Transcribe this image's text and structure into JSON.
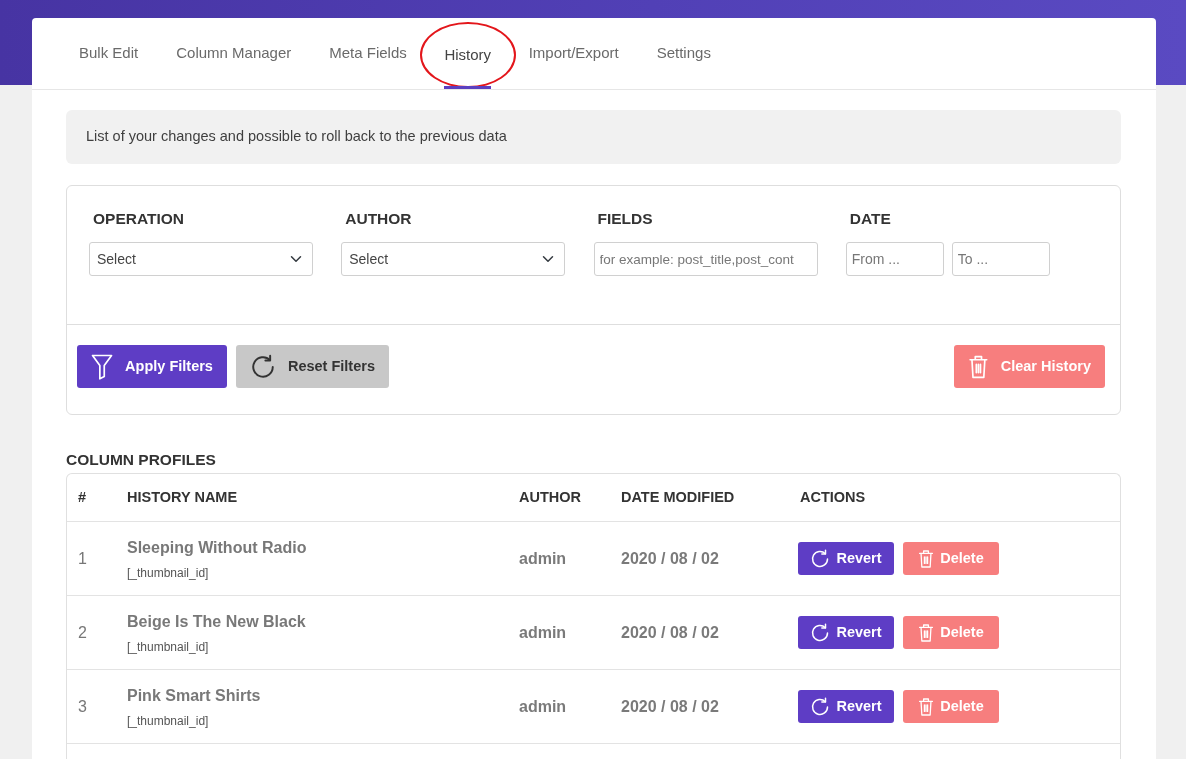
{
  "tabs": [
    {
      "label": "Bulk Edit",
      "selected": false,
      "circled": false
    },
    {
      "label": "Column Manager",
      "selected": false,
      "circled": false
    },
    {
      "label": "Meta Fields",
      "selected": false,
      "circled": false
    },
    {
      "label": "History",
      "selected": true,
      "circled": true
    },
    {
      "label": "Import/Export",
      "selected": false,
      "circled": false
    },
    {
      "label": "Settings",
      "selected": false,
      "circled": false
    }
  ],
  "notice": "List of your changes and possible to roll back to the previous data",
  "filters": [
    {
      "label": "OPERATION",
      "controls": [
        {
          "kind": "select",
          "value": "Select"
        }
      ]
    },
    {
      "label": "AUTHOR",
      "controls": [
        {
          "kind": "select",
          "value": "Select"
        }
      ]
    },
    {
      "label": "FIELDS",
      "controls": [
        {
          "kind": "text",
          "placeholder": "for example: post_title,post_cont"
        }
      ]
    },
    {
      "label": "DATE",
      "controls": [
        {
          "kind": "date",
          "placeholder": "From ..."
        },
        {
          "kind": "date",
          "placeholder": "To ..."
        }
      ]
    }
  ],
  "filter_buttons": [
    {
      "label": "Apply Filters",
      "kind": "apply"
    },
    {
      "label": "Reset Filters",
      "kind": "reset"
    },
    {
      "label": "Clear History",
      "kind": "clear"
    }
  ],
  "section_title": "COLUMN PROFILES",
  "table": {
    "columns": [
      "#",
      "HISTORY NAME",
      "AUTHOR",
      "DATE MODIFIED",
      "ACTIONS"
    ],
    "rows": [
      {
        "index": "1",
        "name": "Sleeping Without Radio",
        "field": "[_thumbnail_id]",
        "author": "admin",
        "date": "2020 / 08 / 02",
        "actions": [
          {
            "label": "Revert",
            "kind": "revert"
          },
          {
            "label": "Delete",
            "kind": "delete"
          }
        ]
      },
      {
        "index": "2",
        "name": "Beige Is The New Black",
        "field": "[_thumbnail_id]",
        "author": "admin",
        "date": "2020 / 08 / 02",
        "actions": [
          {
            "label": "Revert",
            "kind": "revert"
          },
          {
            "label": "Delete",
            "kind": "delete"
          }
        ]
      },
      {
        "index": "3",
        "name": "Pink Smart Shirts",
        "field": "[_thumbnail_id]",
        "author": "admin",
        "date": "2020 / 08 / 02",
        "actions": [
          {
            "label": "Revert",
            "kind": "revert"
          },
          {
            "label": "Delete",
            "kind": "delete"
          }
        ]
      }
    ]
  }
}
